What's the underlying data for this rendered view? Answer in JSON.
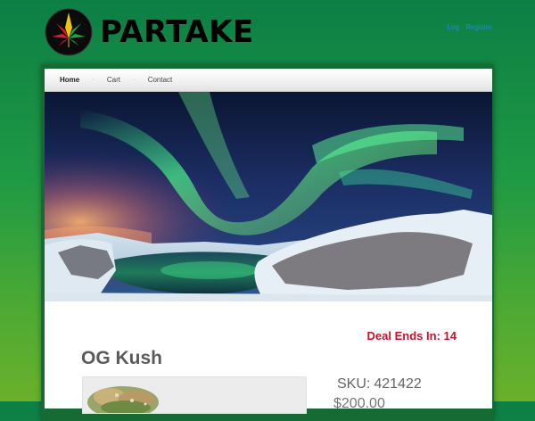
{
  "brand": {
    "name": "PARTAKE",
    "logo_icon": "cannabis-leaf-icon"
  },
  "account": {
    "login_label": "Log",
    "register_label": "Register"
  },
  "nav": {
    "items": [
      "Home",
      "Cart",
      "Contact"
    ],
    "active": "Home"
  },
  "hero": {
    "image": "aurora-borealis-over-snowy-lake"
  },
  "deal": {
    "label": "Deal Ends In:",
    "value": "14"
  },
  "product": {
    "name": "OG Kush",
    "sku_label": "SKU:",
    "sku": "421422",
    "price": "$200.00",
    "image": "og-kush-bud-photo"
  },
  "colors": {
    "background_top": "#0c7f45",
    "background_bottom": "#6ab12b",
    "accent_red": "#c8102e",
    "link_blue": "#1d8bd6"
  }
}
